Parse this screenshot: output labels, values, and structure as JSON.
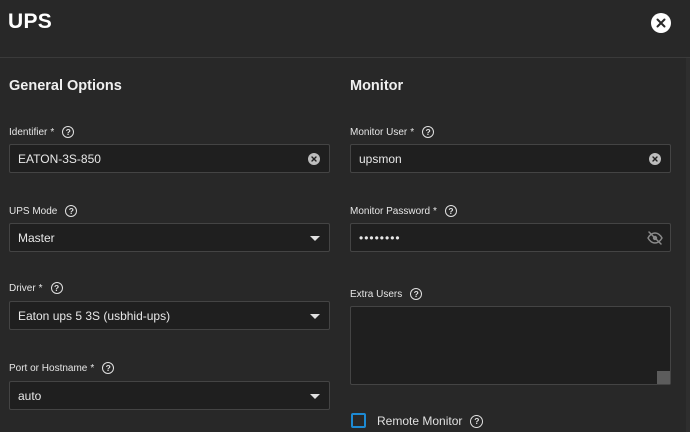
{
  "dialog": {
    "title": "UPS"
  },
  "general": {
    "heading": "General Options",
    "identifier": {
      "label": "Identifier",
      "required": "*",
      "value": "EATON-3S-850"
    },
    "ups_mode": {
      "label": "UPS Mode",
      "value": "Master"
    },
    "driver": {
      "label": "Driver",
      "required": "*",
      "value": "Eaton ups 5 3S (usbhid-ups)"
    },
    "port": {
      "label": "Port or Hostname",
      "required": "*",
      "value": "auto"
    }
  },
  "monitor": {
    "heading": "Monitor",
    "user": {
      "label": "Monitor User",
      "required": "*",
      "value": "upsmon"
    },
    "password": {
      "label": "Monitor Password",
      "required": "*",
      "value": "••••••••"
    },
    "extra_users": {
      "label": "Extra Users",
      "value": ""
    },
    "remote": {
      "label": "Remote Monitor",
      "checked": false
    }
  },
  "icons": {
    "close": "close-icon",
    "help": "help-icon",
    "clear": "clear-icon",
    "dropdown": "chevron-down-icon",
    "visibility": "eye-off-icon"
  },
  "colors": {
    "background": "#282828",
    "field_bg": "#1f1f1f",
    "accent": "#1d8ad3"
  }
}
